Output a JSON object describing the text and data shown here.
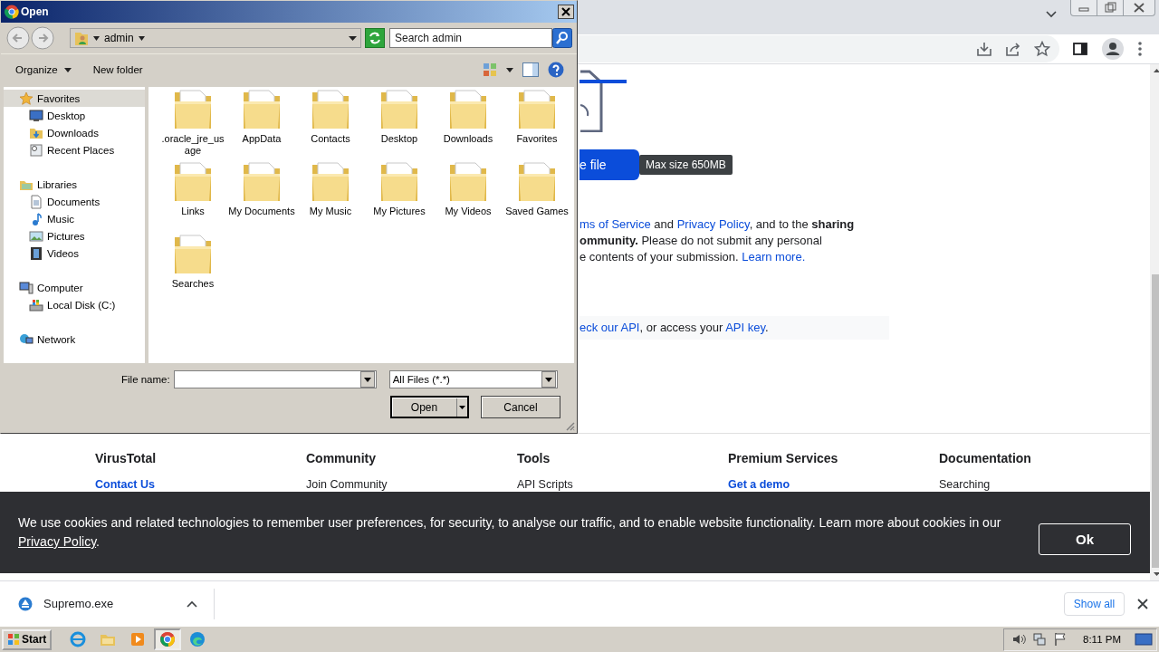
{
  "browser": {
    "upload_button": "e file",
    "tooltip": "Max size 650MB",
    "terms_lines": [
      [
        {
          "text": "ms of Service",
          "kind": "link"
        },
        {
          "text": " and ",
          "kind": "plain"
        },
        {
          "text": "Privacy Policy",
          "kind": "link"
        },
        {
          "text": ", and to the ",
          "kind": "plain"
        },
        {
          "text": "sharing",
          "kind": "bold"
        }
      ],
      [
        {
          "text": "ommunity.",
          "kind": "bold"
        },
        {
          "text": " Please do not submit any personal",
          "kind": "plain"
        }
      ],
      [
        {
          "text": "e contents of your submission. ",
          "kind": "plain"
        },
        {
          "text": "Learn more.",
          "kind": "link"
        }
      ]
    ],
    "api_line": [
      {
        "text": "eck our API",
        "kind": "link"
      },
      {
        "text": ", or access your ",
        "kind": "plain"
      },
      {
        "text": "API key",
        "kind": "link"
      },
      {
        "text": ".",
        "kind": "plain"
      }
    ],
    "footer": [
      {
        "heading": "VirusTotal",
        "links": [
          {
            "label": "Contact Us",
            "highlighted": true
          }
        ]
      },
      {
        "heading": "Community",
        "links": [
          {
            "label": "Join Community",
            "highlighted": false
          }
        ]
      },
      {
        "heading": "Tools",
        "links": [
          {
            "label": "API Scripts",
            "highlighted": false
          }
        ]
      },
      {
        "heading": "Premium Services",
        "links": [
          {
            "label": "Get a demo",
            "highlighted": true
          }
        ]
      },
      {
        "heading": "Documentation",
        "links": [
          {
            "label": "Searching",
            "highlighted": false
          }
        ]
      }
    ],
    "cookie_banner": {
      "text": "We use cookies and related technologies to remember user preferences, for security, to analyse our traffic, and to enable website functionality. Learn more about cookies in our",
      "link": "Privacy Policy",
      "after": ".",
      "button": "Ok"
    },
    "download": {
      "file": "Supremo.exe",
      "show_all": "Show all"
    }
  },
  "dialog": {
    "title": "Open",
    "breadcrumb": "admin",
    "search": {
      "placeholder": "Search admin"
    },
    "toolbar": [
      {
        "label": "Organize",
        "kind": "menu"
      },
      {
        "label": "New folder",
        "kind": "plain"
      }
    ],
    "nav": [
      {
        "label": "Favorites",
        "kind": "star",
        "selected": true,
        "children": [
          {
            "label": "Desktop",
            "kind": "monitor",
            "selected": false
          },
          {
            "label": "Downloads",
            "kind": "folder",
            "selected": false
          },
          {
            "label": "Recent Places",
            "kind": "places",
            "selected": false
          }
        ]
      },
      {
        "label": "Libraries",
        "kind": "library",
        "selected": false,
        "children": [
          {
            "label": "Documents",
            "kind": "document",
            "selected": false
          },
          {
            "label": "Music",
            "kind": "music",
            "selected": false
          },
          {
            "label": "Pictures",
            "kind": "picture",
            "selected": false
          },
          {
            "label": "Videos",
            "kind": "video",
            "selected": false
          }
        ]
      },
      {
        "label": "Computer",
        "kind": "computer",
        "selected": false,
        "children": [
          {
            "label": "Local Disk (C:)",
            "kind": "disk",
            "selected": false
          }
        ]
      },
      {
        "label": "Network",
        "kind": "network",
        "selected": false
      }
    ],
    "files": [
      {
        "label": ".oracle_jre_usage"
      },
      {
        "label": "AppData"
      },
      {
        "label": "Contacts"
      },
      {
        "label": "Desktop"
      },
      {
        "label": "Downloads"
      },
      {
        "label": "Favorites"
      },
      {
        "label": "Links"
      },
      {
        "label": "My Documents"
      },
      {
        "label": "My Music"
      },
      {
        "label": "My Pictures"
      },
      {
        "label": "My Videos"
      },
      {
        "label": "Saved Games"
      },
      {
        "label": "Searches"
      }
    ],
    "file_name": {
      "label": "File name:"
    },
    "file_type": "All Files (*.*)",
    "buttons": [
      {
        "label": "Open",
        "kind": "split"
      },
      {
        "label": "Cancel",
        "kind": "plain"
      }
    ]
  },
  "taskbar": {
    "start": "Start",
    "apps": [
      {
        "kind": "globe",
        "selected": false
      },
      {
        "kind": "folder",
        "selected": false
      },
      {
        "kind": "player",
        "selected": false
      },
      {
        "kind": "round",
        "selected": true
      },
      {
        "kind": "wave",
        "selected": false
      }
    ],
    "clock": "8:11 PM"
  }
}
